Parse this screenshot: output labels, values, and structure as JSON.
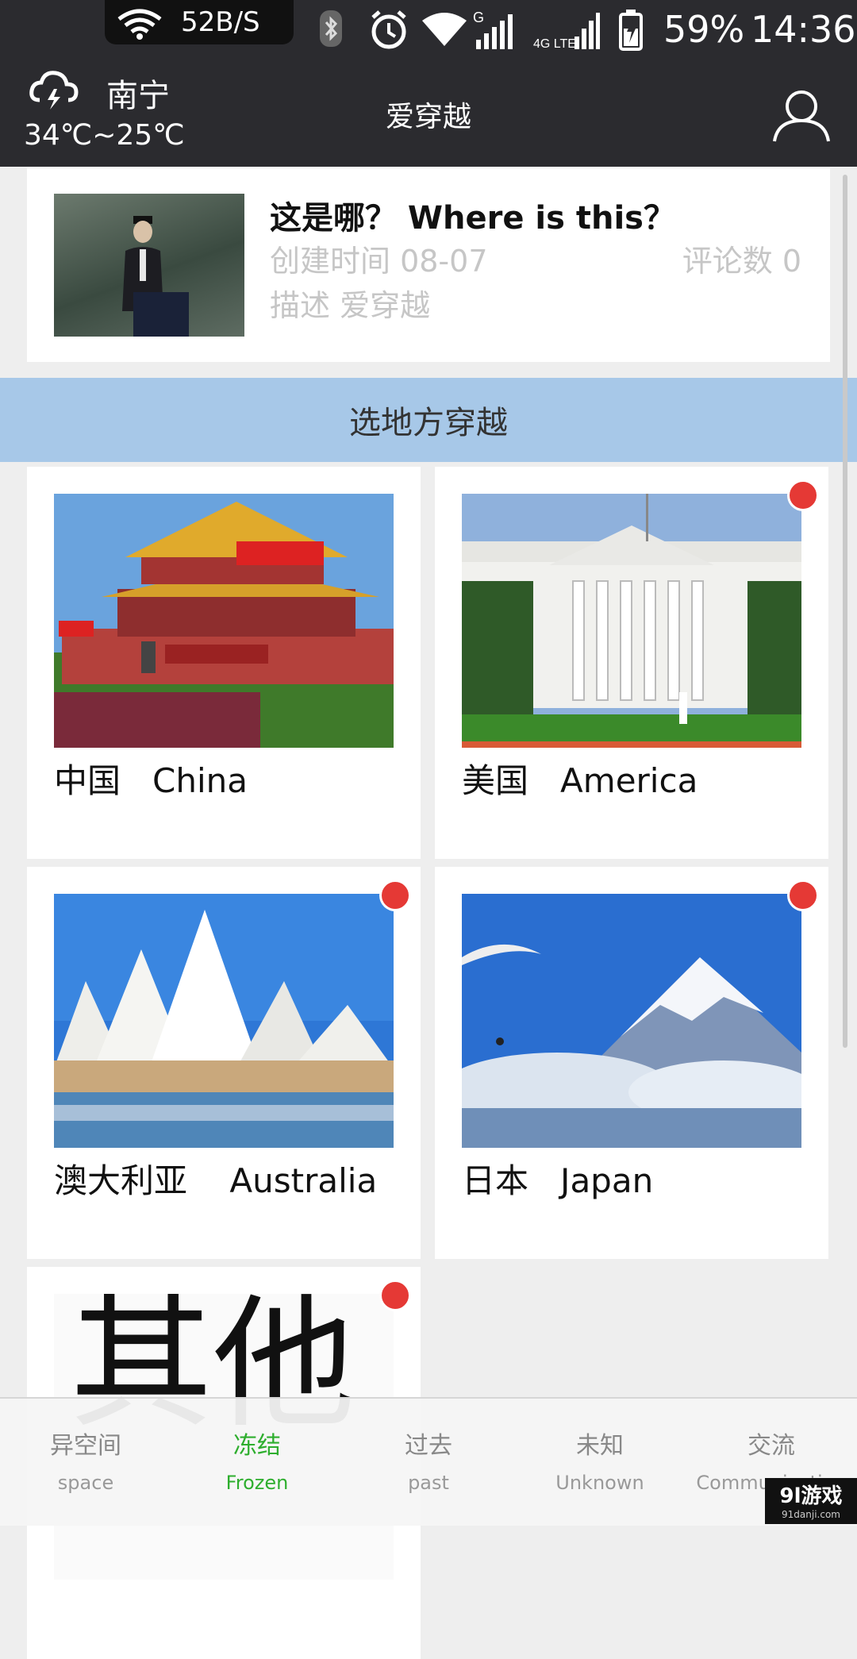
{
  "status_bar": {
    "net_speed": "52B/S",
    "network": "4G LTE",
    "battery": "59%",
    "time": "14:36"
  },
  "header": {
    "city": "南宁",
    "temperature": "34℃~25℃",
    "title": "爱穿越",
    "weather_icon": "thunder-cloud-icon",
    "profile_icon": "user-icon"
  },
  "post": {
    "title": "这是哪？  Where is this？",
    "created": "创建时间 08-07",
    "comments": "评论数 0",
    "description": "描述 爱穿越"
  },
  "section": {
    "title": "选地方穿越"
  },
  "places": [
    {
      "label": "中国   China",
      "has_badge": false
    },
    {
      "label": "美国   America",
      "has_badge": true
    },
    {
      "label": "澳大利亚    Australia",
      "has_badge": true
    },
    {
      "label": "日本   Japan",
      "has_badge": true
    },
    {
      "label": "其他",
      "has_badge": true
    }
  ],
  "bottom_nav": [
    {
      "cn": "异空间",
      "en": "space",
      "active": false
    },
    {
      "cn": "冻结",
      "en": "Frozen",
      "active": true
    },
    {
      "cn": "过去",
      "en": "past",
      "active": false
    },
    {
      "cn": "未知",
      "en": "Unknown",
      "active": false
    },
    {
      "cn": "交流",
      "en": "Communication",
      "active": false
    }
  ],
  "watermark": {
    "main": "9l游戏",
    "sub": "91danji.com"
  },
  "colors": {
    "header_bg": "#2b2b2f",
    "section_bg": "#a7c8e8",
    "active_tab": "#2eae2e",
    "badge": "#e53935"
  }
}
